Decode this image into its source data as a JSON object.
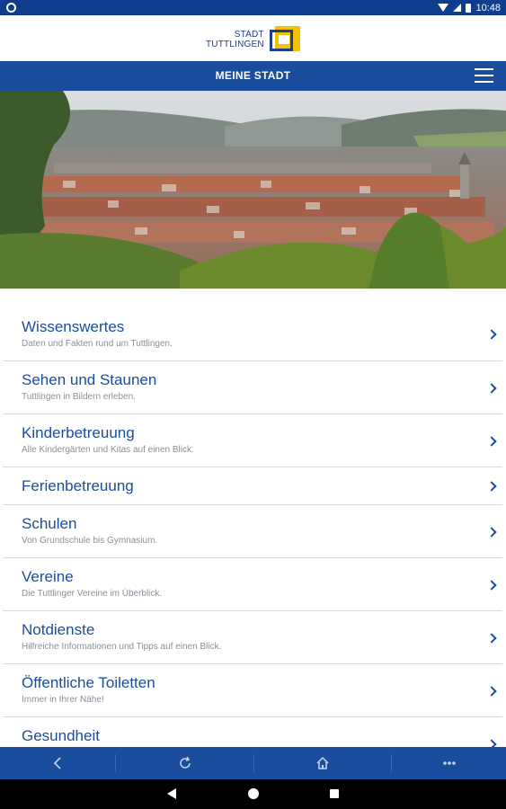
{
  "status_bar": {
    "time": "10:48"
  },
  "brand": {
    "logo_line1": "STADT",
    "logo_line2": "TUTTLINGEN"
  },
  "header": {
    "title": "MEINE STADT"
  },
  "menu": {
    "items": [
      {
        "title": "Wissenswertes",
        "subtitle": "Daten und Fakten rund um Tuttlingen."
      },
      {
        "title": "Sehen und Staunen",
        "subtitle": "Tuttlingen in Bildern erleben."
      },
      {
        "title": "Kinderbetreuung",
        "subtitle": "Alle Kindergärten und Kitas auf einen Blick."
      },
      {
        "title": "Ferienbetreuung",
        "subtitle": ""
      },
      {
        "title": "Schulen",
        "subtitle": "Von Grundschule bis Gymnasium."
      },
      {
        "title": "Vereine",
        "subtitle": "Die Tuttlinger Vereine im Überblick."
      },
      {
        "title": "Notdienste",
        "subtitle": "Hilfreiche Informationen und Tipps auf einen Blick."
      },
      {
        "title": "Öffentliche Toiletten",
        "subtitle": "Immer in Ihrer Nähe!"
      },
      {
        "title": "Gesundheit",
        "subtitle": ""
      }
    ]
  },
  "icons": {
    "back": "chevron-left-icon",
    "reload": "reload-icon",
    "home": "home-icon",
    "more": "more-dots-icon",
    "menu": "hamburger-icon"
  },
  "colors": {
    "primary": "#1a4d9e",
    "status_bar": "#0d3d8c",
    "accent": "#f2c100"
  }
}
